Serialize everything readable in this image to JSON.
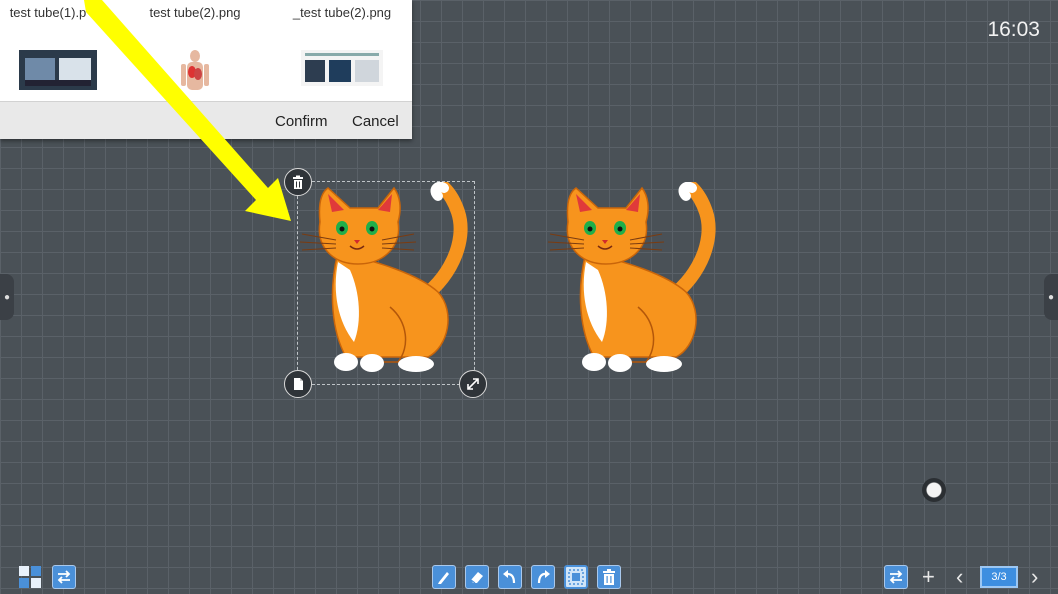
{
  "clock": "16:03",
  "dialog": {
    "files": [
      {
        "name": "test tube(1).p"
      },
      {
        "name": "test tube(2).png"
      },
      {
        "name": "_test tube(2).png"
      }
    ],
    "confirm_label": "Confirm",
    "cancel_label": "Cancel"
  },
  "toolbar": {
    "page_indicator": "3/3"
  },
  "colors": {
    "canvas": "#4a5157",
    "accent": "#4a90d9",
    "arrow": "#ffff00",
    "cat_orange": "#f7941d"
  },
  "icons": {
    "left_toolbar": [
      "grid-icon",
      "switch-icon"
    ],
    "center_toolbar": [
      "pen-icon",
      "eraser-icon",
      "undo-icon",
      "redo-icon",
      "select-icon",
      "trash-icon"
    ],
    "right_toolbar": [
      "switch-icon",
      "add-page-icon",
      "prev-page-icon",
      "next-page-icon"
    ]
  }
}
